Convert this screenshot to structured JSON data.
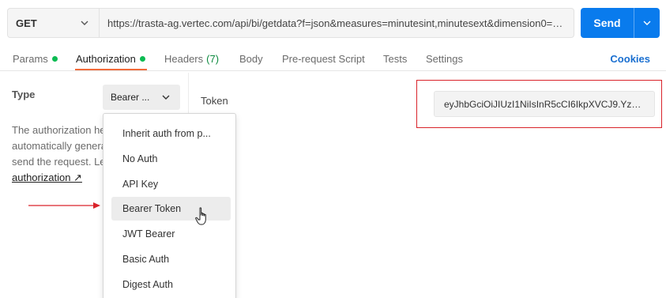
{
  "request": {
    "method": "GET",
    "url": "https://trasta-ag.vertec.com/api/bi/getdata?f=json&measures=minutesint,minutesext&dimension0=F…",
    "send_label": "Send"
  },
  "tabs": [
    {
      "label": "Params",
      "dot": true
    },
    {
      "label": "Authorization",
      "dot": true,
      "active": true
    },
    {
      "label": "Headers",
      "count": "(7)"
    },
    {
      "label": "Body"
    },
    {
      "label": "Pre-request Script"
    },
    {
      "label": "Tests"
    },
    {
      "label": "Settings"
    }
  ],
  "cookies_label": "Cookies",
  "auth": {
    "type_label": "Type",
    "selected_type": "Bearer ...",
    "description_lines": [
      "The authorization he",
      "automatically genera",
      "send the request. Le"
    ],
    "description_link": "authorization ↗",
    "token_label": "Token",
    "token_value": "eyJhbGciOiJIUzI1NiIsInR5cCI6IkpXVCJ9.Yz…"
  },
  "dropdown": {
    "items": [
      "Inherit auth from p...",
      "No Auth",
      "API Key",
      "Bearer Token",
      "JWT Bearer",
      "Basic Auth",
      "Digest Auth"
    ],
    "hovered": "Bearer Token"
  },
  "colors": {
    "send_button": "#097bed",
    "active_tab_underline": "#f26b3a",
    "status_dot": "#0cbb52",
    "annotation_red": "#d9232a",
    "cookies_link": "#1a6fd0"
  },
  "icons": [
    "chevron-down-icon",
    "hand-pointer-icon",
    "external-link-icon"
  ]
}
